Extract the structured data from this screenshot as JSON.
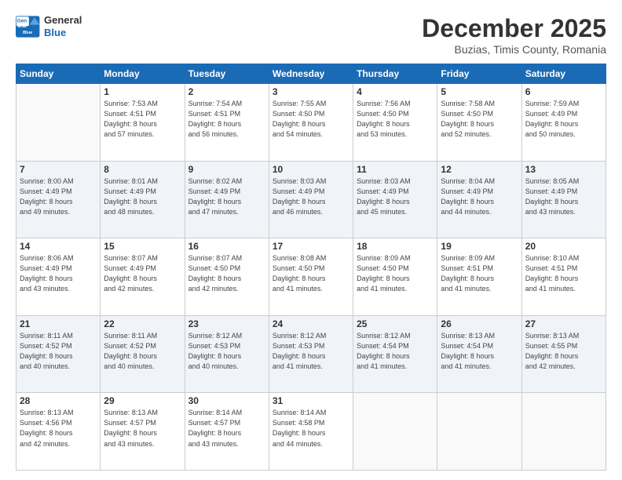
{
  "header": {
    "logo_line1": "General",
    "logo_line2": "Blue",
    "title": "December 2025",
    "subtitle": "Buzias, Timis County, Romania"
  },
  "weekdays": [
    "Sunday",
    "Monday",
    "Tuesday",
    "Wednesday",
    "Thursday",
    "Friday",
    "Saturday"
  ],
  "weeks": [
    [
      {
        "day": "",
        "sunrise": "",
        "sunset": "",
        "daylight": ""
      },
      {
        "day": "1",
        "sunrise": "Sunrise: 7:53 AM",
        "sunset": "Sunset: 4:51 PM",
        "daylight": "Daylight: 8 hours and 57 minutes."
      },
      {
        "day": "2",
        "sunrise": "Sunrise: 7:54 AM",
        "sunset": "Sunset: 4:51 PM",
        "daylight": "Daylight: 8 hours and 56 minutes."
      },
      {
        "day": "3",
        "sunrise": "Sunrise: 7:55 AM",
        "sunset": "Sunset: 4:50 PM",
        "daylight": "Daylight: 8 hours and 54 minutes."
      },
      {
        "day": "4",
        "sunrise": "Sunrise: 7:56 AM",
        "sunset": "Sunset: 4:50 PM",
        "daylight": "Daylight: 8 hours and 53 minutes."
      },
      {
        "day": "5",
        "sunrise": "Sunrise: 7:58 AM",
        "sunset": "Sunset: 4:50 PM",
        "daylight": "Daylight: 8 hours and 52 minutes."
      },
      {
        "day": "6",
        "sunrise": "Sunrise: 7:59 AM",
        "sunset": "Sunset: 4:49 PM",
        "daylight": "Daylight: 8 hours and 50 minutes."
      }
    ],
    [
      {
        "day": "7",
        "sunrise": "Sunrise: 8:00 AM",
        "sunset": "Sunset: 4:49 PM",
        "daylight": "Daylight: 8 hours and 49 minutes."
      },
      {
        "day": "8",
        "sunrise": "Sunrise: 8:01 AM",
        "sunset": "Sunset: 4:49 PM",
        "daylight": "Daylight: 8 hours and 48 minutes."
      },
      {
        "day": "9",
        "sunrise": "Sunrise: 8:02 AM",
        "sunset": "Sunset: 4:49 PM",
        "daylight": "Daylight: 8 hours and 47 minutes."
      },
      {
        "day": "10",
        "sunrise": "Sunrise: 8:03 AM",
        "sunset": "Sunset: 4:49 PM",
        "daylight": "Daylight: 8 hours and 46 minutes."
      },
      {
        "day": "11",
        "sunrise": "Sunrise: 8:03 AM",
        "sunset": "Sunset: 4:49 PM",
        "daylight": "Daylight: 8 hours and 45 minutes."
      },
      {
        "day": "12",
        "sunrise": "Sunrise: 8:04 AM",
        "sunset": "Sunset: 4:49 PM",
        "daylight": "Daylight: 8 hours and 44 minutes."
      },
      {
        "day": "13",
        "sunrise": "Sunrise: 8:05 AM",
        "sunset": "Sunset: 4:49 PM",
        "daylight": "Daylight: 8 hours and 43 minutes."
      }
    ],
    [
      {
        "day": "14",
        "sunrise": "Sunrise: 8:06 AM",
        "sunset": "Sunset: 4:49 PM",
        "daylight": "Daylight: 8 hours and 43 minutes."
      },
      {
        "day": "15",
        "sunrise": "Sunrise: 8:07 AM",
        "sunset": "Sunset: 4:49 PM",
        "daylight": "Daylight: 8 hours and 42 minutes."
      },
      {
        "day": "16",
        "sunrise": "Sunrise: 8:07 AM",
        "sunset": "Sunset: 4:50 PM",
        "daylight": "Daylight: 8 hours and 42 minutes."
      },
      {
        "day": "17",
        "sunrise": "Sunrise: 8:08 AM",
        "sunset": "Sunset: 4:50 PM",
        "daylight": "Daylight: 8 hours and 41 minutes."
      },
      {
        "day": "18",
        "sunrise": "Sunrise: 8:09 AM",
        "sunset": "Sunset: 4:50 PM",
        "daylight": "Daylight: 8 hours and 41 minutes."
      },
      {
        "day": "19",
        "sunrise": "Sunrise: 8:09 AM",
        "sunset": "Sunset: 4:51 PM",
        "daylight": "Daylight: 8 hours and 41 minutes."
      },
      {
        "day": "20",
        "sunrise": "Sunrise: 8:10 AM",
        "sunset": "Sunset: 4:51 PM",
        "daylight": "Daylight: 8 hours and 41 minutes."
      }
    ],
    [
      {
        "day": "21",
        "sunrise": "Sunrise: 8:11 AM",
        "sunset": "Sunset: 4:52 PM",
        "daylight": "Daylight: 8 hours and 40 minutes."
      },
      {
        "day": "22",
        "sunrise": "Sunrise: 8:11 AM",
        "sunset": "Sunset: 4:52 PM",
        "daylight": "Daylight: 8 hours and 40 minutes."
      },
      {
        "day": "23",
        "sunrise": "Sunrise: 8:12 AM",
        "sunset": "Sunset: 4:53 PM",
        "daylight": "Daylight: 8 hours and 40 minutes."
      },
      {
        "day": "24",
        "sunrise": "Sunrise: 8:12 AM",
        "sunset": "Sunset: 4:53 PM",
        "daylight": "Daylight: 8 hours and 41 minutes."
      },
      {
        "day": "25",
        "sunrise": "Sunrise: 8:12 AM",
        "sunset": "Sunset: 4:54 PM",
        "daylight": "Daylight: 8 hours and 41 minutes."
      },
      {
        "day": "26",
        "sunrise": "Sunrise: 8:13 AM",
        "sunset": "Sunset: 4:54 PM",
        "daylight": "Daylight: 8 hours and 41 minutes."
      },
      {
        "day": "27",
        "sunrise": "Sunrise: 8:13 AM",
        "sunset": "Sunset: 4:55 PM",
        "daylight": "Daylight: 8 hours and 42 minutes."
      }
    ],
    [
      {
        "day": "28",
        "sunrise": "Sunrise: 8:13 AM",
        "sunset": "Sunset: 4:56 PM",
        "daylight": "Daylight: 8 hours and 42 minutes."
      },
      {
        "day": "29",
        "sunrise": "Sunrise: 8:13 AM",
        "sunset": "Sunset: 4:57 PM",
        "daylight": "Daylight: 8 hours and 43 minutes."
      },
      {
        "day": "30",
        "sunrise": "Sunrise: 8:14 AM",
        "sunset": "Sunset: 4:57 PM",
        "daylight": "Daylight: 8 hours and 43 minutes."
      },
      {
        "day": "31",
        "sunrise": "Sunrise: 8:14 AM",
        "sunset": "Sunset: 4:58 PM",
        "daylight": "Daylight: 8 hours and 44 minutes."
      },
      {
        "day": "",
        "sunrise": "",
        "sunset": "",
        "daylight": ""
      },
      {
        "day": "",
        "sunrise": "",
        "sunset": "",
        "daylight": ""
      },
      {
        "day": "",
        "sunrise": "",
        "sunset": "",
        "daylight": ""
      }
    ]
  ]
}
